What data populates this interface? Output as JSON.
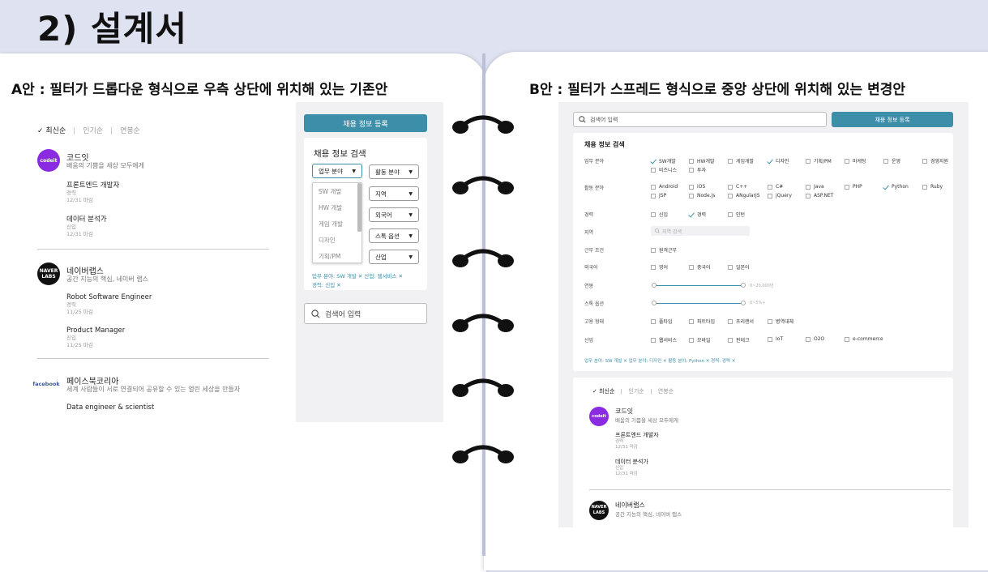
{
  "title": "2) 설계서",
  "left": {
    "heading": "A안 : 필터가 드롭다운 형식으로 우측 상단에 위치해 있는 기존안",
    "sort": [
      "✓ 최신순",
      "인기순",
      "연봉순"
    ],
    "companies": [
      {
        "logo": "codeit",
        "name": "코드잇",
        "desc": "배움의 기쁨을 세상 모두에게",
        "jobs": [
          {
            "title": "프론트엔드 개발자",
            "meta": [
              "경력",
              "12/31 마감"
            ]
          },
          {
            "title": "데이터 분석가",
            "meta": [
              "신입",
              "12/31 마감"
            ]
          }
        ]
      },
      {
        "logo": "NAVER LABS",
        "name": "네이버랩스",
        "desc": "공간 지능의 핵심, 네이버 랩스",
        "jobs": [
          {
            "title": "Robot Software Engineer",
            "meta": [
              "경력",
              "11/25 마감"
            ]
          },
          {
            "title": "Product Manager",
            "meta": [
              "신입",
              "11/25 마감"
            ]
          }
        ]
      },
      {
        "logo": "facebook",
        "name": "페이스북코리아",
        "desc": "세계 사람들이 서로 연결되어 공유할 수 있는 열린 세상을 만들자",
        "jobs": [
          {
            "title": "Data engineer & scientist",
            "meta": []
          }
        ]
      }
    ],
    "register_button": "채용 정보 등록",
    "filter_title": "채용 정보 검색",
    "selects": [
      "업무 분야",
      "활동 분야",
      "지역",
      "외국어",
      "스톡 옵션",
      "산업"
    ],
    "dropdown_options": [
      "SW 개발",
      "HW 개발",
      "게임 개발",
      "디자인",
      "기획/PM"
    ],
    "chips_line1": "업무 분야: SW 개발 ✕   산업: 웹서비스 ✕",
    "chips_line2": "경력: 신입 ✕",
    "search_placeholder": "검색어 입력"
  },
  "right": {
    "heading": "B안 : 필터가 스프레드 형식으로 중앙 상단에 위치해 있는 변경안",
    "search_placeholder": "검색어 입력",
    "register_button": "채용 정보 등록",
    "filter_title": "채용 정보 검색",
    "rows": {
      "work": {
        "label": "업무 분야",
        "options": [
          "SW개발",
          "HW개발",
          "게임개발",
          "디자인",
          "기획/PM",
          "마케팅",
          "운영",
          "경영지원",
          "비즈니스",
          "투자"
        ]
      },
      "activity": {
        "label": "활동 분야",
        "options": [
          "Android",
          "iOS",
          "C++",
          "C#",
          "Java",
          "PHP",
          "Python",
          "Ruby",
          "JSP",
          "Node.js",
          "ANgularJS",
          "jQuery",
          "ASP.NET"
        ]
      },
      "career": {
        "label": "경력",
        "options": [
          "신입",
          "경력",
          "인턴"
        ]
      },
      "region": {
        "label": "지역",
        "placeholder": "지역 검색"
      },
      "conditions": {
        "label": "근무 조건",
        "options": [
          "원격근무"
        ]
      },
      "language": {
        "label": "외국어",
        "options": [
          "영어",
          "중국어",
          "일본어"
        ]
      },
      "salary": {
        "label": "연봉",
        "range": "0~20,000만"
      },
      "stock": {
        "label": "스톡 옵션",
        "range": "0~5%+"
      },
      "employment": {
        "label": "고용 형태",
        "options": [
          "풀타임",
          "파트타임",
          "프리랜서",
          "병역대체"
        ]
      },
      "industry": {
        "label": "산업",
        "options": [
          "웹서비스",
          "모바일",
          "핀테크",
          "IoT",
          "O2O",
          "e-commerce"
        ]
      }
    },
    "chips": "업무 분야: SW 개발 ✕   업무 분야: 디자인 ✕   활동 분야: Python ✕   경력: 경력 ✕",
    "sort": [
      "✓ 최신순",
      "인기순",
      "연봉순"
    ],
    "companies": [
      {
        "logo": "codeit",
        "name": "코드잇",
        "desc": "배움의 기쁨을 세상 모두에게",
        "jobs": [
          {
            "title": "프론트엔드 개발자",
            "meta": [
              "경력",
              "12/31 마감"
            ]
          },
          {
            "title": "데이터 분석가",
            "meta": [
              "신입",
              "12/31 마감"
            ]
          }
        ]
      },
      {
        "logo": "NAVER LABS",
        "name": "네이버랩스",
        "desc": "공간 지능의 핵심, 네이버 랩스"
      }
    ]
  },
  "colors": {
    "accent": "#3d8ea8",
    "background": "#dfe3f1",
    "codeit": "#8a2be2"
  }
}
